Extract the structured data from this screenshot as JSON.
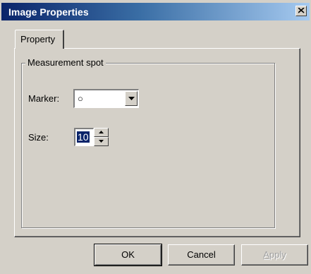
{
  "window": {
    "title": "Image Properties"
  },
  "tabs": [
    {
      "label": "Property"
    }
  ],
  "group": {
    "label": "Measurement spot",
    "marker": {
      "label": "Marker:",
      "value": "○"
    },
    "size": {
      "label": "Size:",
      "value": "10"
    }
  },
  "buttons": {
    "ok": "OK",
    "cancel": "Cancel",
    "apply_underlined": "A",
    "apply_rest": "pply"
  },
  "colors": {
    "titlebar_start": "#0a246a",
    "titlebar_end": "#a6caf0",
    "dialog_bg": "#d4d0c8"
  }
}
